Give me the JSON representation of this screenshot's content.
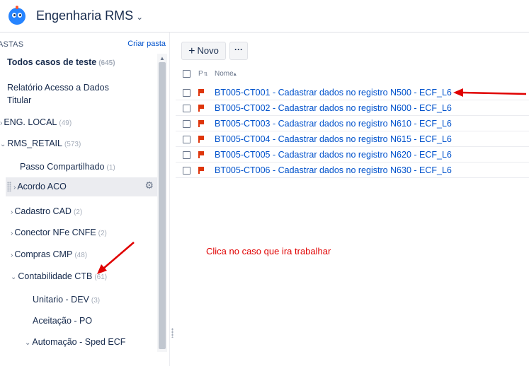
{
  "header": {
    "project_title": "Engenharia RMS",
    "logo_icon": "robot-avatar-icon"
  },
  "sidebar": {
    "folders_label": "ASTAS",
    "create_folder_label": "Criar pasta",
    "items": [
      {
        "label": "Todos casos de teste",
        "count": "(645)"
      },
      {
        "label": "Relatório Acesso a Dados",
        "label2": "Titular"
      },
      {
        "label": "ENG. LOCAL",
        "count": "(49)"
      },
      {
        "label": "RMS_RETAIL",
        "count": "(573)"
      },
      {
        "label": "Passo Compartilhado",
        "count": "(1)"
      },
      {
        "label": "Acordo ACO"
      },
      {
        "label": "Cadastro CAD",
        "count": "(2)"
      },
      {
        "label": "Conector NFe CNFE",
        "count": "(2)"
      },
      {
        "label": "Compras CMP",
        "count": "(48)"
      },
      {
        "label": "Contabilidade CTB",
        "count": "(61)"
      },
      {
        "label": "Unitario - DEV",
        "count": "(3)"
      },
      {
        "label": "Aceitação - PO"
      },
      {
        "label": "Automação - Sped ECF"
      }
    ]
  },
  "toolbar": {
    "new_label": "Novo",
    "more_label": "···"
  },
  "table": {
    "col_priority": "P",
    "col_name": "Nome",
    "sort_indicator": "▴",
    "rows": [
      {
        "name": "BT005-CT001 - Cadastrar dados no registro N500 - ECF_L6"
      },
      {
        "name": "BT005-CT002 - Cadastrar dados no registro N600 - ECF_L6"
      },
      {
        "name": "BT005-CT003 - Cadastrar dados no registro N610 - ECF_L6"
      },
      {
        "name": "BT005-CT004 - Cadastrar dados no registro N615 - ECF_L6"
      },
      {
        "name": "BT005-CT005 - Cadastrar dados no registro N620 - ECF_L6"
      },
      {
        "name": "BT005-CT006 - Cadastrar dados no registro N630 - ECF_L6"
      }
    ]
  },
  "annotation": {
    "text": "Clica no caso que ira trabalhar",
    "color": "#e00000"
  },
  "colors": {
    "link": "#0052cc",
    "flag": "#de350b",
    "accent": "#2684ff"
  }
}
